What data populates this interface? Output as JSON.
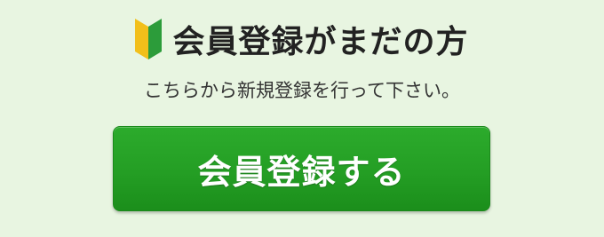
{
  "register_section": {
    "heading": "会員登録がまだの方",
    "description": "こちらから新規登録を行って下さい。",
    "button_label": "会員登録する",
    "icon": "beginner-mark-icon"
  },
  "colors": {
    "background": "#e8f5e1",
    "button_green": "#249e24",
    "icon_yellow": "#f2bf1a",
    "icon_green": "#2c9c3a"
  }
}
